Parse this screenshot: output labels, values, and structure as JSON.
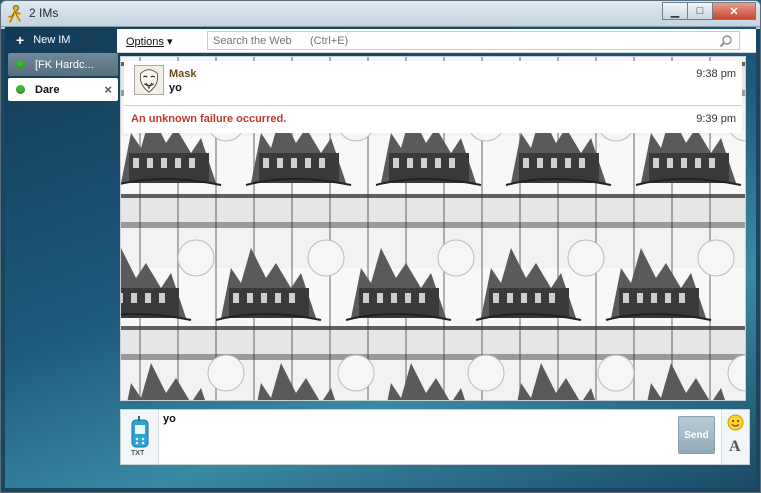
{
  "window": {
    "title": "2 IMs",
    "controls": {
      "minimize": "▭",
      "maximize": "□",
      "close": "✕"
    }
  },
  "sidebar": {
    "new_im_label": "New IM",
    "tabs": [
      {
        "label": "[FK Hardc...",
        "status": "online",
        "active": false
      },
      {
        "label": "Dare",
        "status": "online",
        "active": true,
        "close": "×"
      }
    ]
  },
  "toolbar": {
    "options_label": "Options",
    "search_placeholder": "Search the Web      (Ctrl+E)"
  },
  "conversation": {
    "messages": [
      {
        "sender": "Mask",
        "text": "yo",
        "time": "9:38 pm"
      }
    ],
    "error": {
      "text": "An unknown failure occurred.",
      "time": "9:39 pm"
    }
  },
  "compose": {
    "txt_label": "TXT",
    "input_value": "yo",
    "send_label": "Send",
    "font_label": "A"
  },
  "colors": {
    "status_online": "#3ab832",
    "error_text": "#c0392b",
    "sender_name": "#6b4a20"
  }
}
